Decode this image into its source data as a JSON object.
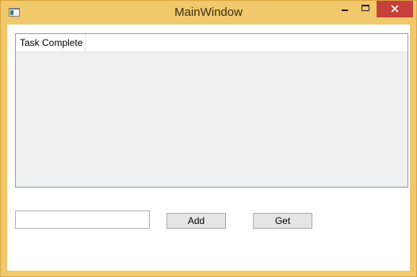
{
  "window": {
    "title": "MainWindow",
    "icons": {
      "app": "app-window-icon",
      "minimize": "minimize-icon",
      "maximize": "maximize-icon",
      "close": "close-icon"
    },
    "colors": {
      "frame": "#f1c86b",
      "close_button": "#c7403a"
    }
  },
  "listview": {
    "columns": [
      {
        "label": "Task Complete"
      }
    ],
    "rows": []
  },
  "input": {
    "value": "",
    "placeholder": ""
  },
  "buttons": {
    "add_label": "Add",
    "get_label": "Get"
  }
}
